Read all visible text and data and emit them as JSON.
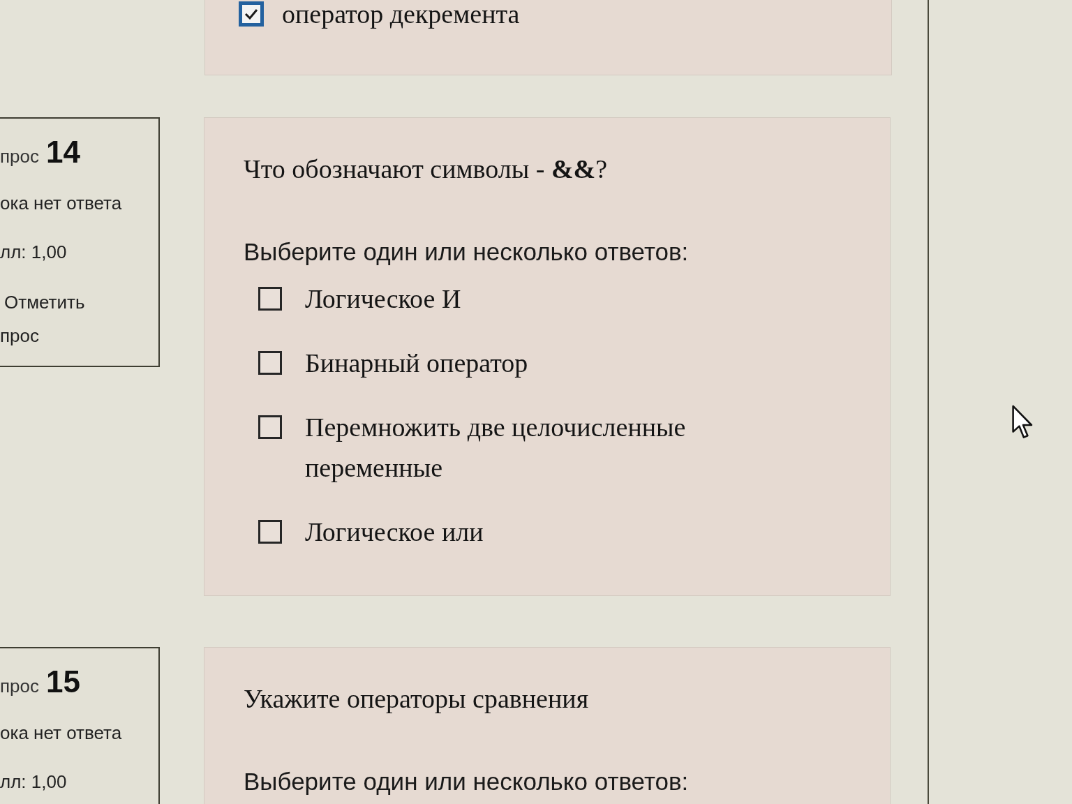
{
  "previous_question": {
    "options": [
      {
        "label": "оператор декремента",
        "checked": true
      }
    ]
  },
  "questions": [
    {
      "info": {
        "number_label": "прос",
        "number": "14",
        "status": "ока нет ответа",
        "mark": "лл: 1,00",
        "flag_lines": [
          "Отметить",
          "прос"
        ]
      },
      "text": "Что обозначают символы - **&&**?",
      "prompt": "Выберите один или несколько ответов:",
      "options": [
        {
          "label": "Логическое И",
          "checked": false
        },
        {
          "label": "Бинарный оператор",
          "checked": false
        },
        {
          "label": "Перемножить две целочисленные переменные",
          "checked": false
        },
        {
          "label": "Логическое или",
          "checked": false
        }
      ]
    },
    {
      "info": {
        "number_label": "прос",
        "number": "15",
        "status": "ока нет ответа",
        "mark": "лл: 1,00"
      },
      "text": "Укажите операторы сравнения",
      "prompt": "Выберите один или несколько ответов:"
    }
  ]
}
